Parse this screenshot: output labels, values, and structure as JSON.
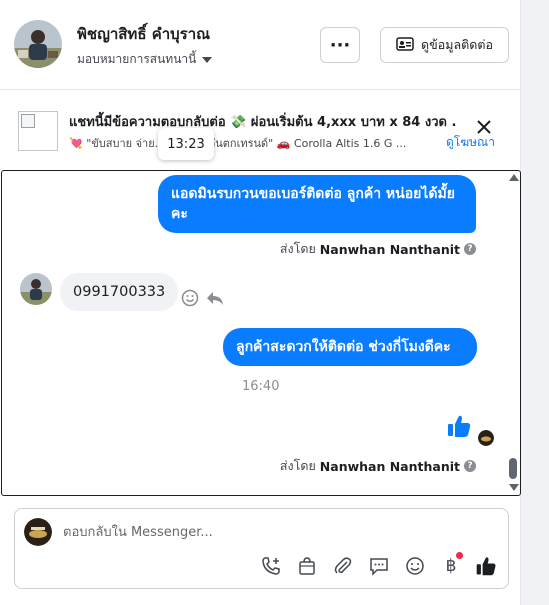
{
  "header": {
    "contact_name": "พิชญาสิทธิ์ คำบุราณ",
    "assign_label": "มอบหมายการสนทนานี้",
    "more_label": "···",
    "contact_info_label": "ดูข้อมูลติดต่อ"
  },
  "ad_context": {
    "title": "แชทนี้มีข้อความตอบกลับต่อ 💸 ผ่อนเริ่มต้น 4,xxx บาท x 84 งวด .",
    "subtitle": "💘 \"ขับสบาย จ่าย... ...ย ไม่มีวันตกเทรนด์\" 🚗 Corolla Altis 1.6 G ...",
    "link_label": "ดูโฆษณา",
    "tooltip_time": "13:23"
  },
  "messages": {
    "outgoing_1": "แอดมินรบกวนขอเบอร์ติดต่อ ลูกค้า  หน่อยได้มั้ยคะ",
    "sent_by_1": {
      "prefix": "ส่งโดย",
      "name": "Nanwhan Nanthanit",
      "icon": "info-icon"
    },
    "incoming_1": "0991700333",
    "outgoing_2": "ลูกค้าสะดวกให้ติดต่อ ช่วงกี่โมงดีคะ",
    "timestamp": "16:40",
    "outgoing_like": "thumbs-up-icon",
    "sent_by_2": {
      "prefix": "ส่งโดย",
      "name": "Nanwhan Nanthanit",
      "icon": "info-icon"
    }
  },
  "composer": {
    "placeholder": "ตอบกลับใน Messenger...",
    "tools": [
      "phone-add-icon",
      "shopping-bag-icon",
      "paperclip-icon",
      "saved-reply-icon",
      "emoji-icon",
      "baht-icon",
      "like-icon"
    ],
    "baht_symbol": "฿"
  },
  "colors": {
    "accent": "#0a7cff",
    "incoming_bubble": "#f0f2f5",
    "notification_dot": "#f02849"
  }
}
